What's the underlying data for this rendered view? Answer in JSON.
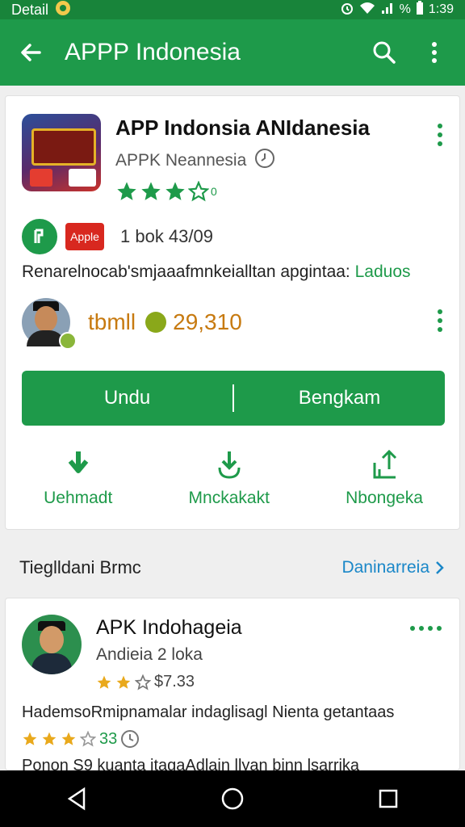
{
  "status_bar": {
    "label": "Detail",
    "battery_percent": "%",
    "time": "1:39"
  },
  "app_bar": {
    "title": "APPP Indonesia"
  },
  "app": {
    "title": "APP Indonsia ANIdanesia",
    "developer": "APPK Neannesia",
    "rating_stars": 3.5,
    "rating_text": "0",
    "badge_label": "Apple",
    "size_text": "1 bok 43/09",
    "description": "Renarelnocab'smjaaafmnkeialltan apgintaa:",
    "description_link": "Laduos"
  },
  "owner": {
    "name": "tbmll",
    "count": "29,310"
  },
  "primary_button": {
    "left_label": "Undu",
    "right_label": "Bengkam"
  },
  "actions": [
    {
      "label": "Uehmadt",
      "icon": "download-icon"
    },
    {
      "label": "Mnckakakt",
      "icon": "download-hand-icon"
    },
    {
      "label": "Nbongeka",
      "icon": "share-icon"
    }
  ],
  "section": {
    "title": "Tieglldani Brmc",
    "link": "Daninarreia"
  },
  "related": {
    "title": "APK Indohageia",
    "subtitle": "Andieia 2 loka",
    "rating_stars": 2.5,
    "rating_value": "$7.33",
    "description": "HademsoRmipnamalar indaglisagl Nienta getantaas",
    "rating2_stars": 3.5,
    "rating2_value": "33",
    "description2": "Ponon S9 kuanta itagaAdlain llyan binn lsarrika"
  },
  "colors": {
    "primary": "#1e9a4a",
    "primary_dark": "#18843a",
    "owner": "#c77a10",
    "link": "#1a87c8",
    "star_gold": "#e9a91c"
  }
}
